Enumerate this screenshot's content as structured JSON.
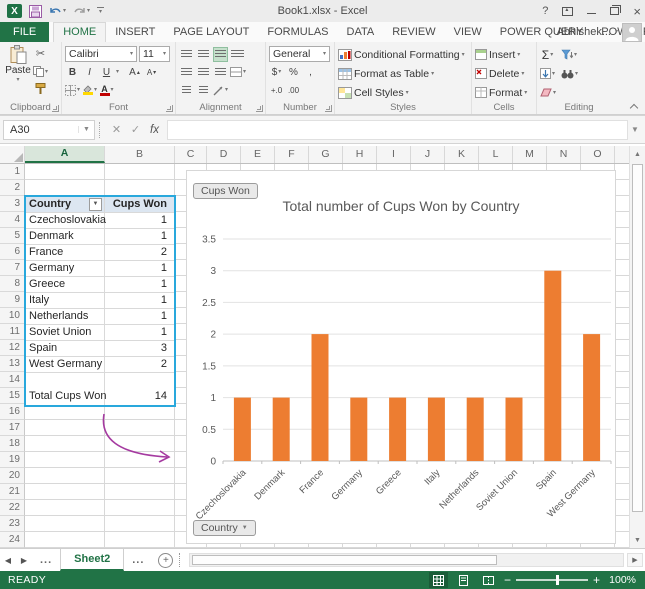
{
  "window": {
    "title": "Book1.xlsx - Excel",
    "help_icon": "?"
  },
  "ribbon": {
    "tabs": [
      {
        "label": "FILE"
      },
      {
        "label": "HOME"
      },
      {
        "label": "INSERT"
      },
      {
        "label": "PAGE LAYOUT"
      },
      {
        "label": "FORMULAS"
      },
      {
        "label": "DATA"
      },
      {
        "label": "REVIEW"
      },
      {
        "label": "VIEW"
      },
      {
        "label": "POWER QUERY"
      },
      {
        "label": "POWERPIVOT"
      }
    ],
    "active_tab": "HOME",
    "user_name": "Abhishek...",
    "clipboard": {
      "group": "Clipboard",
      "paste": "Paste"
    },
    "font": {
      "group": "Font",
      "name": "Calibri",
      "size": "11",
      "bold": "B",
      "italic": "I",
      "underline": "U"
    },
    "alignment": {
      "group": "Alignment"
    },
    "number": {
      "group": "Number",
      "format": "General",
      "currency": "$",
      "percent": "%",
      "comma": ",",
      "inc_decimal": "+.0",
      "dec_decimal": ".00"
    },
    "styles": {
      "group": "Styles",
      "items": [
        "Conditional Formatting",
        "Format as Table",
        "Cell Styles"
      ]
    },
    "cells": {
      "group": "Cells",
      "items": [
        "Insert",
        "Delete",
        "Format"
      ]
    },
    "editing": {
      "group": "Editing",
      "autosum": "Σ"
    }
  },
  "formula_bar": {
    "name_box": "A30",
    "formula": "",
    "cancel_glyph": "✕",
    "enter_glyph": "✓",
    "fx_glyph": "fx"
  },
  "grid": {
    "columns": [
      "A",
      "B",
      "C",
      "D",
      "E",
      "F",
      "G",
      "H",
      "I",
      "J",
      "K",
      "L",
      "M",
      "N",
      "O"
    ],
    "selected_column": "A",
    "row_count": 24
  },
  "table": {
    "headers": [
      "Country",
      "Cups Won"
    ],
    "rows": [
      [
        "Czechoslovakia",
        "1"
      ],
      [
        "Denmark",
        "1"
      ],
      [
        "France",
        "2"
      ],
      [
        "Germany",
        "1"
      ],
      [
        "Greece",
        "1"
      ],
      [
        "Italy",
        "1"
      ],
      [
        "Netherlands",
        "1"
      ],
      [
        "Soviet Union",
        "1"
      ],
      [
        "Spain",
        "3"
      ],
      [
        "West Germany",
        "2"
      ]
    ],
    "total_label": "Total Cups Won",
    "total_value": "14"
  },
  "chart_data": {
    "type": "bar",
    "title": "Total number of Cups Won by Country",
    "categories": [
      "Czechoslovakia",
      "Denmark",
      "France",
      "Germany",
      "Greece",
      "Italy",
      "Netherlands",
      "Soviet Union",
      "Spain",
      "West Germany"
    ],
    "values": [
      1,
      1,
      2,
      1,
      1,
      1,
      1,
      1,
      3,
      2
    ],
    "xlabel": "",
    "ylabel": "",
    "ylim": [
      0,
      3.5
    ],
    "yticks": [
      0,
      0.5,
      1,
      1.5,
      2,
      2.5,
      3,
      3.5
    ],
    "grid": true,
    "legend": "none",
    "bar_color": "#ED7D31",
    "field_buttons": {
      "value": "Cups Won",
      "axis": "Country"
    }
  },
  "sheet_tabs": {
    "active": "Sheet2",
    "overflow_left": "...",
    "overflow_right": "..."
  },
  "status_bar": {
    "mode": "READY",
    "zoom": "100%",
    "zoom_out": "−",
    "zoom_in": "+"
  },
  "colors": {
    "excel_green": "#217346",
    "bar_orange": "#ED7D31",
    "range_border_blue": "#29A8DC",
    "table_header_fill": "#DCE6F1",
    "annotation_arrow_purple": "#A53AA0",
    "chart_text_gray": "#595959"
  }
}
